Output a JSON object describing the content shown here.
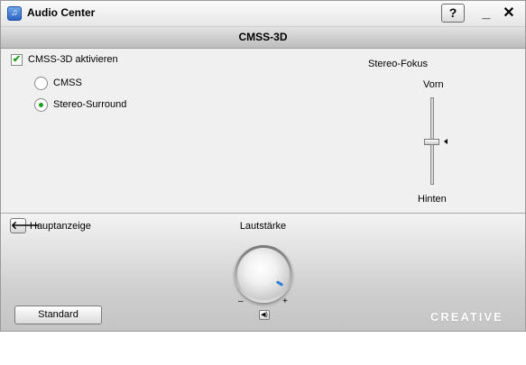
{
  "window": {
    "title": "Audio Center",
    "help_label": "?",
    "minimize_label": "_",
    "close_label": "✕"
  },
  "section": {
    "title": "CMSS-3D"
  },
  "cmss": {
    "enable_label": "CMSS-3D aktivieren",
    "enabled": true,
    "options": [
      {
        "label": "CMSS",
        "selected": false
      },
      {
        "label": "Stereo-Surround",
        "selected": true
      }
    ]
  },
  "stereo_focus": {
    "title": "Stereo-Fokus",
    "top_label": "Vorn",
    "bottom_label": "Hinten",
    "value": 0.5
  },
  "bottom": {
    "back_label": "Hauptanzeige",
    "volume_label": "Lautstärke",
    "volume_minus": "–",
    "volume_plus": "+",
    "volume_level": 0.95,
    "standard_label": "Standard",
    "logo": "CREATIVE"
  },
  "icons": {
    "app": "music-note-icon",
    "back": "arrow-left-icon",
    "mute": "speaker-icon"
  },
  "colors": {
    "accent_green": "#1e9e1e",
    "knob_indicator": "#2e7dd6"
  }
}
